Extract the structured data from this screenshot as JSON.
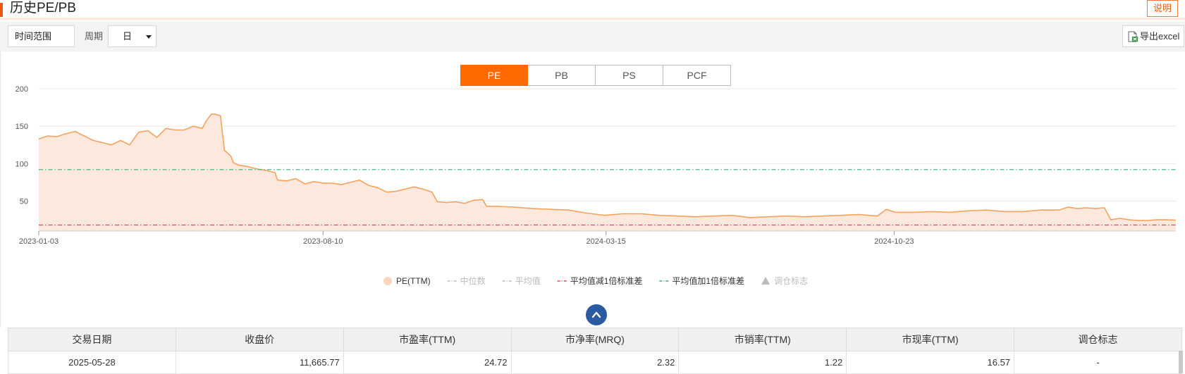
{
  "header": {
    "title": "历史PE/PB",
    "explain_label": "说明"
  },
  "toolbar": {
    "range_label": "时间范围",
    "period_label": "周期",
    "period_value": "日",
    "export_label": "导出excel"
  },
  "tabs": [
    {
      "label": "PE",
      "active": true
    },
    {
      "label": "PB",
      "active": false
    },
    {
      "label": "PS",
      "active": false
    },
    {
      "label": "PCF",
      "active": false
    }
  ],
  "colors": {
    "accent": "#ff6a00",
    "line": "#f5a35c",
    "area": "#fde8de",
    "upper_band": "#3fae7a",
    "lower_band": "#e0455a"
  },
  "chart_data": {
    "type": "area",
    "title": "",
    "xlabel": "",
    "ylabel": "",
    "ylim": [
      10,
      200
    ],
    "yticks": [
      50,
      100,
      150,
      200
    ],
    "x_range": [
      "2023-01-03",
      "2025-05-28"
    ],
    "xticks": [
      "2023-01-03",
      "2023-08-10",
      "2024-03-15",
      "2024-10-23"
    ],
    "grid": true,
    "legend_position": "bottom",
    "legend": [
      {
        "label": "PE(TTM)",
        "marker": "circle",
        "color": "#fbd5bd",
        "active": true
      },
      {
        "label": "中位数",
        "marker": "dashdot",
        "color": "#bbbbbb",
        "active": false
      },
      {
        "label": "平均值",
        "marker": "dashdot",
        "color": "#bbbbbb",
        "active": false
      },
      {
        "label": "平均值减1倍标准差",
        "marker": "dashdot",
        "color": "#e0455a",
        "active": true
      },
      {
        "label": "平均值加1倍标准差",
        "marker": "dashdot",
        "color": "#3fae7a",
        "active": true
      },
      {
        "label": "调仓标志",
        "marker": "triangle",
        "color": "#bbbbbb",
        "active": false
      }
    ],
    "reference_lines": [
      {
        "name": "平均值加1倍标准差",
        "value": 92
      },
      {
        "name": "平均值减1倍标准差",
        "value": 18
      }
    ],
    "series": [
      {
        "name": "PE(TTM)",
        "points": [
          [
            "2023-01-03",
            133
          ],
          [
            "2023-01-10",
            137
          ],
          [
            "2023-01-17",
            136
          ],
          [
            "2023-01-24",
            140
          ],
          [
            "2023-01-31",
            143
          ],
          [
            "2023-02-07",
            137
          ],
          [
            "2023-02-14",
            131
          ],
          [
            "2023-02-21",
            128
          ],
          [
            "2023-02-28",
            125
          ],
          [
            "2023-03-07",
            131
          ],
          [
            "2023-03-14",
            125
          ],
          [
            "2023-03-21",
            142
          ],
          [
            "2023-03-28",
            144
          ],
          [
            "2023-04-04",
            135
          ],
          [
            "2023-04-11",
            147
          ],
          [
            "2023-04-18",
            145
          ],
          [
            "2023-04-25",
            145
          ],
          [
            "2023-05-02",
            150
          ],
          [
            "2023-05-09",
            147
          ],
          [
            "2023-05-12",
            157
          ],
          [
            "2023-05-16",
            166
          ],
          [
            "2023-05-19",
            166
          ],
          [
            "2023-05-23",
            164
          ],
          [
            "2023-05-26",
            118
          ],
          [
            "2023-05-31",
            110
          ],
          [
            "2023-06-02",
            101
          ],
          [
            "2023-06-06",
            98
          ],
          [
            "2023-06-13",
            96
          ],
          [
            "2023-06-20",
            93
          ],
          [
            "2023-06-27",
            91
          ],
          [
            "2023-07-04",
            88
          ],
          [
            "2023-07-06",
            78
          ],
          [
            "2023-07-13",
            77
          ],
          [
            "2023-07-20",
            80
          ],
          [
            "2023-07-27",
            73
          ],
          [
            "2023-08-03",
            76
          ],
          [
            "2023-08-10",
            74
          ],
          [
            "2023-08-17",
            74
          ],
          [
            "2023-08-24",
            72
          ],
          [
            "2023-08-31",
            75
          ],
          [
            "2023-09-07",
            78
          ],
          [
            "2023-09-14",
            71
          ],
          [
            "2023-09-21",
            68
          ],
          [
            "2023-09-28",
            62
          ],
          [
            "2023-10-05",
            63
          ],
          [
            "2023-10-12",
            66
          ],
          [
            "2023-10-19",
            69
          ],
          [
            "2023-10-26",
            66
          ],
          [
            "2023-11-02",
            62
          ],
          [
            "2023-11-06",
            49
          ],
          [
            "2023-11-13",
            48
          ],
          [
            "2023-11-20",
            49
          ],
          [
            "2023-11-27",
            47
          ],
          [
            "2023-12-04",
            51
          ],
          [
            "2023-12-11",
            52
          ],
          [
            "2023-12-14",
            43
          ],
          [
            "2023-12-21",
            43
          ],
          [
            "2024-01-04",
            42
          ],
          [
            "2024-01-18",
            40
          ],
          [
            "2024-02-01",
            39
          ],
          [
            "2024-02-15",
            38
          ],
          [
            "2024-02-29",
            34
          ],
          [
            "2024-03-14",
            31
          ],
          [
            "2024-03-28",
            33
          ],
          [
            "2024-04-11",
            33
          ],
          [
            "2024-04-25",
            31
          ],
          [
            "2024-05-09",
            30
          ],
          [
            "2024-05-23",
            29
          ],
          [
            "2024-06-06",
            30
          ],
          [
            "2024-06-20",
            31
          ],
          [
            "2024-07-04",
            28
          ],
          [
            "2024-07-18",
            29
          ],
          [
            "2024-08-01",
            30
          ],
          [
            "2024-08-15",
            29
          ],
          [
            "2024-08-29",
            30
          ],
          [
            "2024-09-12",
            31
          ],
          [
            "2024-09-26",
            32
          ],
          [
            "2024-10-03",
            31
          ],
          [
            "2024-10-10",
            30
          ],
          [
            "2024-10-17",
            39
          ],
          [
            "2024-10-24",
            35
          ],
          [
            "2024-11-07",
            35
          ],
          [
            "2024-11-21",
            36
          ],
          [
            "2024-12-05",
            35
          ],
          [
            "2024-12-19",
            37
          ],
          [
            "2025-01-02",
            38
          ],
          [
            "2025-01-16",
            36
          ],
          [
            "2025-01-30",
            36
          ],
          [
            "2025-02-13",
            38
          ],
          [
            "2025-02-27",
            38
          ],
          [
            "2025-03-06",
            42
          ],
          [
            "2025-03-13",
            40
          ],
          [
            "2025-03-20",
            41
          ],
          [
            "2025-03-27",
            40
          ],
          [
            "2025-04-03",
            41
          ],
          [
            "2025-04-08",
            25
          ],
          [
            "2025-04-15",
            27
          ],
          [
            "2025-04-22",
            25
          ],
          [
            "2025-04-29",
            24
          ],
          [
            "2025-05-06",
            24
          ],
          [
            "2025-05-13",
            25
          ],
          [
            "2025-05-20",
            25
          ],
          [
            "2025-05-28",
            24.72
          ]
        ]
      }
    ]
  },
  "table": {
    "headers": [
      "交易日期",
      "收盘价",
      "市盈率(TTM)",
      "市净率(MRQ)",
      "市销率(TTM)",
      "市现率(TTM)",
      "调仓标志"
    ],
    "rows": [
      [
        "2025-05-28",
        "11,665.77",
        "24.72",
        "2.32",
        "1.22",
        "16.57",
        "-"
      ]
    ]
  }
}
